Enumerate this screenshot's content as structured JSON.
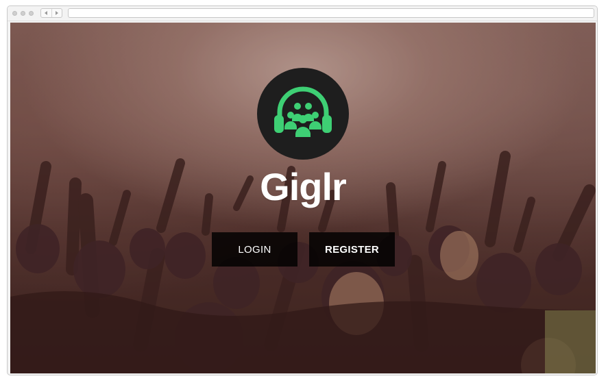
{
  "app": {
    "brand_name": "Giglr",
    "logo_icon": "headphones-crowd-icon",
    "accent_color": "#3ecf74",
    "logo_bg_color": "#1e1e1e"
  },
  "actions": {
    "login_label": "LOGIN",
    "register_label": "REGISTER"
  },
  "browser": {
    "back_icon": "back-arrow-icon",
    "forward_icon": "forward-arrow-icon",
    "address": ""
  }
}
